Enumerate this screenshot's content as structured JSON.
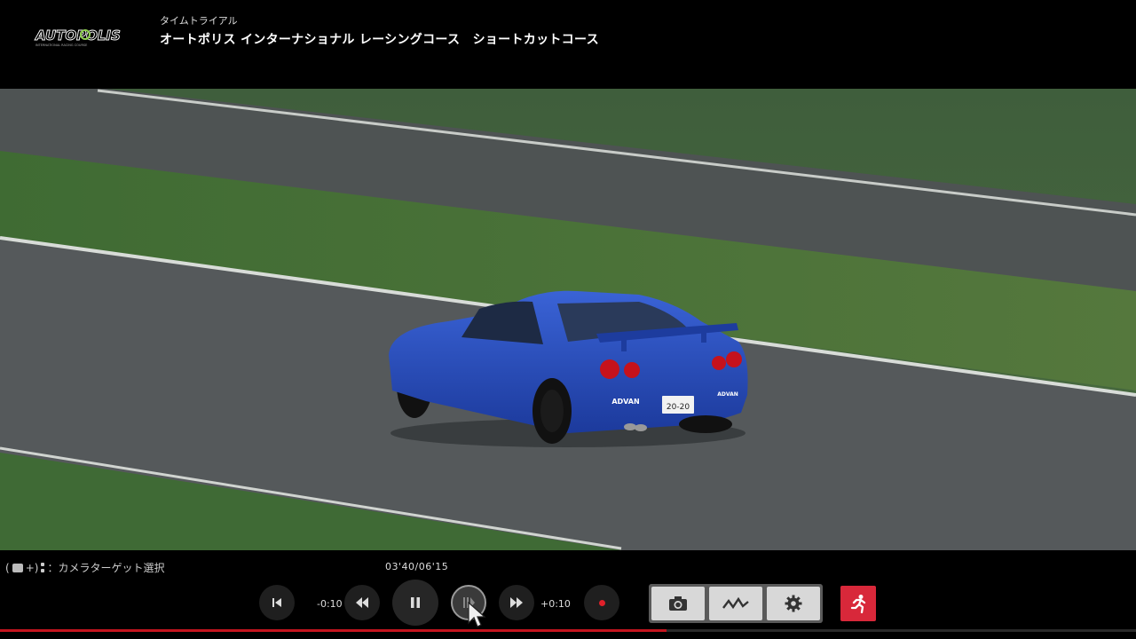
{
  "header": {
    "logo_text": "AUTOPOLIS",
    "logo_subtext": "INTERNATIONAL RACING COURSE",
    "mode_label": "タイムトライアル",
    "course_name": "オートポリス インターナショナル レーシングコース　ショートカットコース"
  },
  "scene": {
    "car_plate": "20-20",
    "bumper_brand": "ADVAN"
  },
  "controls": {
    "camera_hint_prefix": "(",
    "camera_hint_plus": "+)",
    "camera_hint_label": "：カメラターゲット選択",
    "timecode": "03'40/06'15",
    "jump_back_label": "-0:10",
    "jump_forward_label": "+0:10",
    "progress": 0.587
  },
  "icons": {
    "skip_start": "skip-to-start-icon",
    "rewind": "rewind-icon",
    "pause": "pause-icon",
    "step": "frame-step-icon",
    "fast_forward": "fast-forward-icon",
    "record": "record-icon",
    "camera": "camera-icon",
    "telemetry": "telemetry-icon",
    "settings": "gear-icon",
    "exit": "exit-running-icon"
  },
  "colors": {
    "accent_red": "#d8283a",
    "progress_red": "#c4151f",
    "logo_green": "#8fd14f",
    "car_blue": "#2a4fc4"
  }
}
